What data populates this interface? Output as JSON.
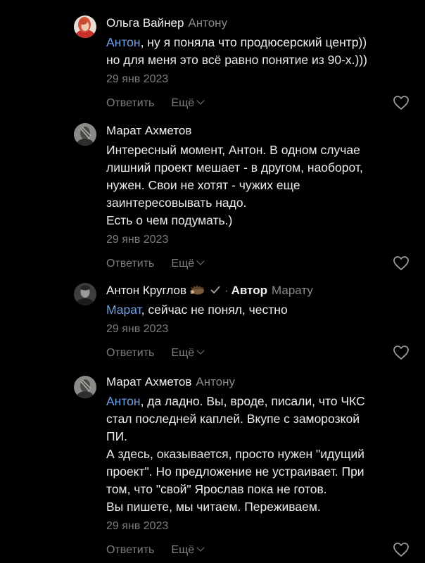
{
  "comments": [
    {
      "author": "Ольга Вайнер",
      "reply_to": "Антону",
      "mention": "Антон",
      "text": ", ну я поняла что продюсерский центр))\nно для меня это всё равно понятие из 90-х.)))",
      "date": "29 янв 2023",
      "reply_label": "Ответить",
      "more_label": "Ещё",
      "avatar": "woman-red-hair"
    },
    {
      "author": "Марат Ахметов",
      "reply_to": "",
      "mention": "",
      "text": "Интересный момент, Антон. В одном случае\nлишний проект мешает - в другом, наоборот,\nнужен. Свои не хотят - чужих еще\nзаинтересовывать надо.\nЕсть о чем подумать.)",
      "date": "29 янв 2023",
      "reply_label": "Ответить",
      "more_label": "Ещё",
      "avatar": "man-bw-portrait"
    },
    {
      "author": "Антон Круглов",
      "author_suffix_icon": "hedgehog-emoji",
      "verified_icon": "checkmark-icon",
      "badge": "Автор",
      "badge_separator": "·",
      "reply_to": "Марату",
      "mention": "Марат",
      "text": ", сейчас не понял, честно",
      "date": "29 янв 2023",
      "reply_label": "Ответить",
      "more_label": "Ещё",
      "avatar": "man-dark-portrait"
    },
    {
      "author": "Марат Ахметов",
      "reply_to": "Антону",
      "mention": "Антон",
      "text": ", да ладно. Вы, вроде, писали, что ЧКС\nстал последней каплей. Вкупе с заморозкой\nПИ.\nА здесь, оказывается, просто нужен \"идущий\nпроект\". Но предложение не устраивает. При\nтом, что \"свой\" Ярослав пока не готов.\nВы пишете, мы читаем. Переживаем.",
      "date": "29 янв 2023",
      "reply_label": "Ответить",
      "more_label": "Ещё",
      "avatar": "man-bw-portrait"
    }
  ],
  "colors": {
    "background": "#000000",
    "text": "#ececec",
    "muted": "#7d7d82",
    "mention": "#6e9fe6"
  }
}
